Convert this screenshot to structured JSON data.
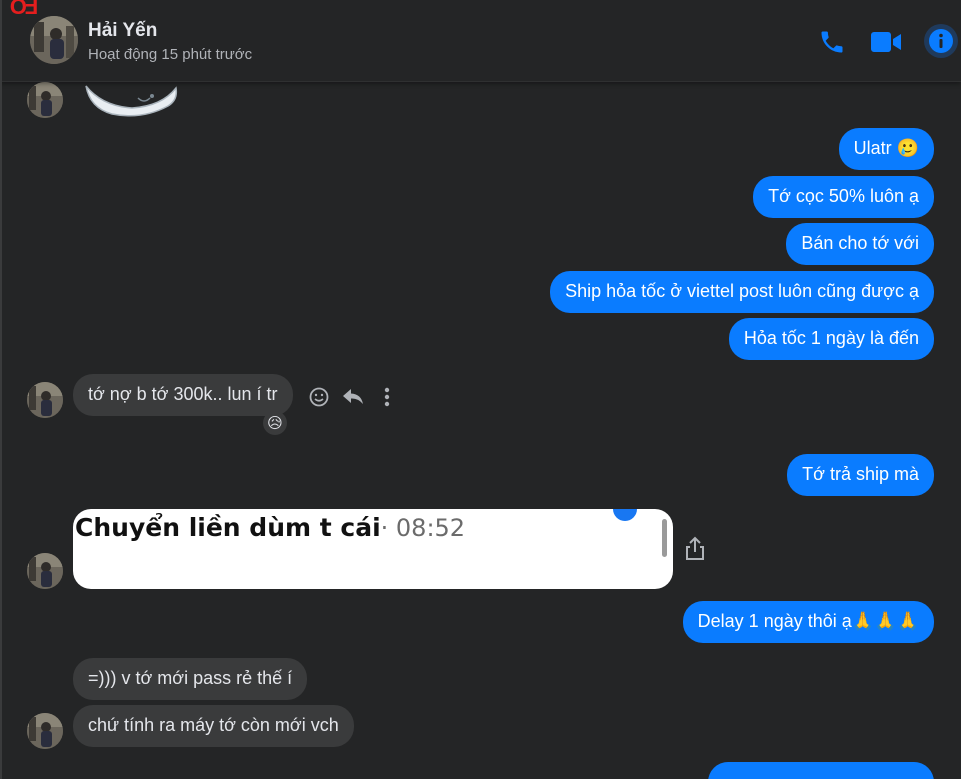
{
  "header": {
    "contact_name": "Hải Yến",
    "status": "Hoạt động 15 phút trước",
    "corner_mark": "FO",
    "icons": [
      "phone-icon",
      "video-icon",
      "info-icon"
    ],
    "accent_color": "#0a7cff"
  },
  "messages": {
    "out_1": "Ulatr 🥲",
    "out_2": "Tớ cọc 50% luôn ạ",
    "out_3": "Bán cho tớ với",
    "out_4": "Ship hỏa tốc ở viettel post luôn cũng được ạ",
    "out_5": "Hỏa tốc 1 ngày là đến",
    "in_1": "tớ nợ b tớ 300k.. lun í tr",
    "in_1_reaction": "😥",
    "out_6": "Tớ trả ship mà",
    "image_caption": "Chuyển liền dùm t cái",
    "image_time": "· 08:52",
    "out_7": "Delay 1 ngày thôi ạ🙏🙏🙏",
    "in_2": "=))) v tớ mới pass rẻ thế í",
    "in_3": "chứ tính ra máy tớ còn mới vch"
  },
  "colors": {
    "background": "#242526",
    "incoming_bubble": "#3a3b3c",
    "outgoing_bubble": "#0a7cff"
  }
}
